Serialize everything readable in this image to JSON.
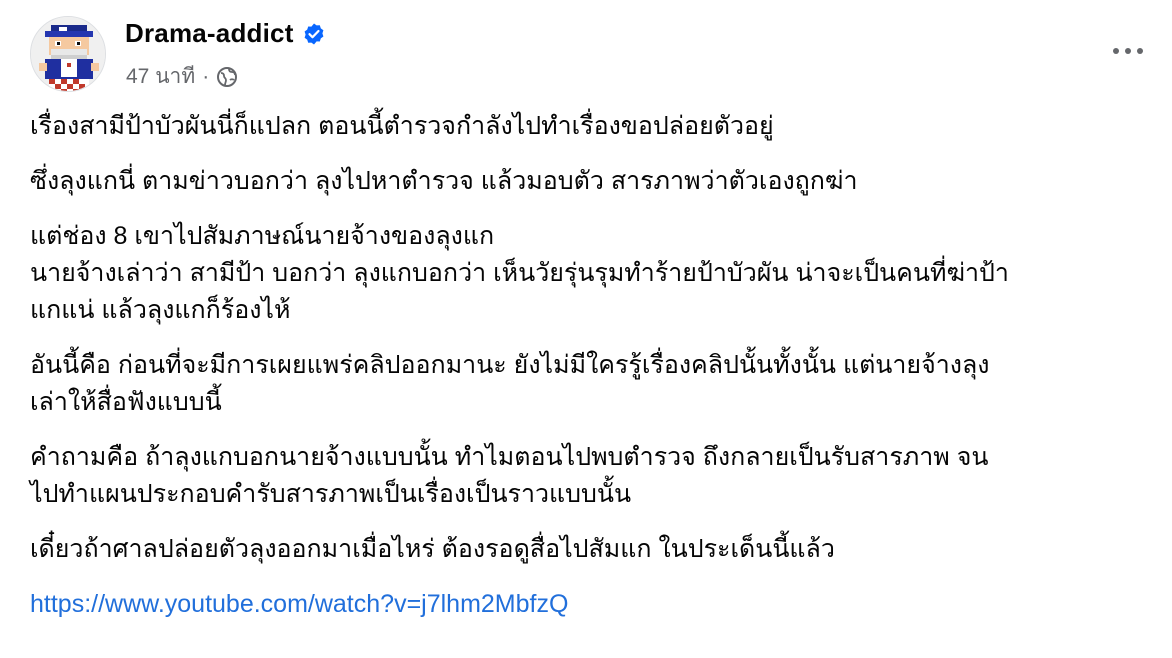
{
  "post": {
    "author": "Drama-addict",
    "verified": true,
    "time": "47 นาที",
    "separator": "·",
    "audience_icon": "globe-icon",
    "more_icon": "more-horizontal-icon",
    "paragraphs": [
      "เรื่องสามีป้าบัวผันนี่ก็แปลก ตอนนี้ตำรวจกำลังไปทำเรื่องขอปล่อยตัวอยู่",
      "ซึ่งลุงแกนี่ ตามข่าวบอกว่า ลุงไปหาตำรวจ แล้วมอบตัว สารภาพว่าตัวเองถูกฆ่า",
      "แต่ช่อง 8 เขาไปสัมภาษณ์นายจ้างของลุงแก\nนายจ้างเล่าว่า สามีป้า บอกว่า ลุงแกบอกว่า เห็นวัยรุ่นรุมทำร้ายป้าบัวผัน น่าจะเป็นคนที่ฆ่าป้า\nแกแน่ แล้วลุงแกก็ร้องไห้",
      "อันนี้คือ ก่อนที่จะมีการเผยแพร่คลิปออกมานะ ยังไม่มีใครรู้เรื่องคลิปนั้นทั้งนั้น แต่นายจ้างลุง\nเล่าให้สื่อฟังแบบนี้",
      "คำถามคือ ถ้าลุงแกบอกนายจ้างแบบนั้น ทำไมตอนไปพบตำรวจ ถึงกลายเป็นรับสารภาพ จน\nไปทำแผนประกอบคำรับสารภาพเป็นเรื่องเป็นราวแบบนั้น",
      "เดี๋ยวถ้าศาลปล่อยตัวลุงออกมาเมื่อไหร่ ต้องรอดูสื่อไปสัมแก ในประเด็นนี้แล้ว"
    ],
    "link": "https://www.youtube.com/watch?v=j7lhm2MbfzQ"
  },
  "colors": {
    "link": "#216fdb",
    "verified": "#0866ff",
    "meta": "#65676b",
    "text": "#050505"
  }
}
